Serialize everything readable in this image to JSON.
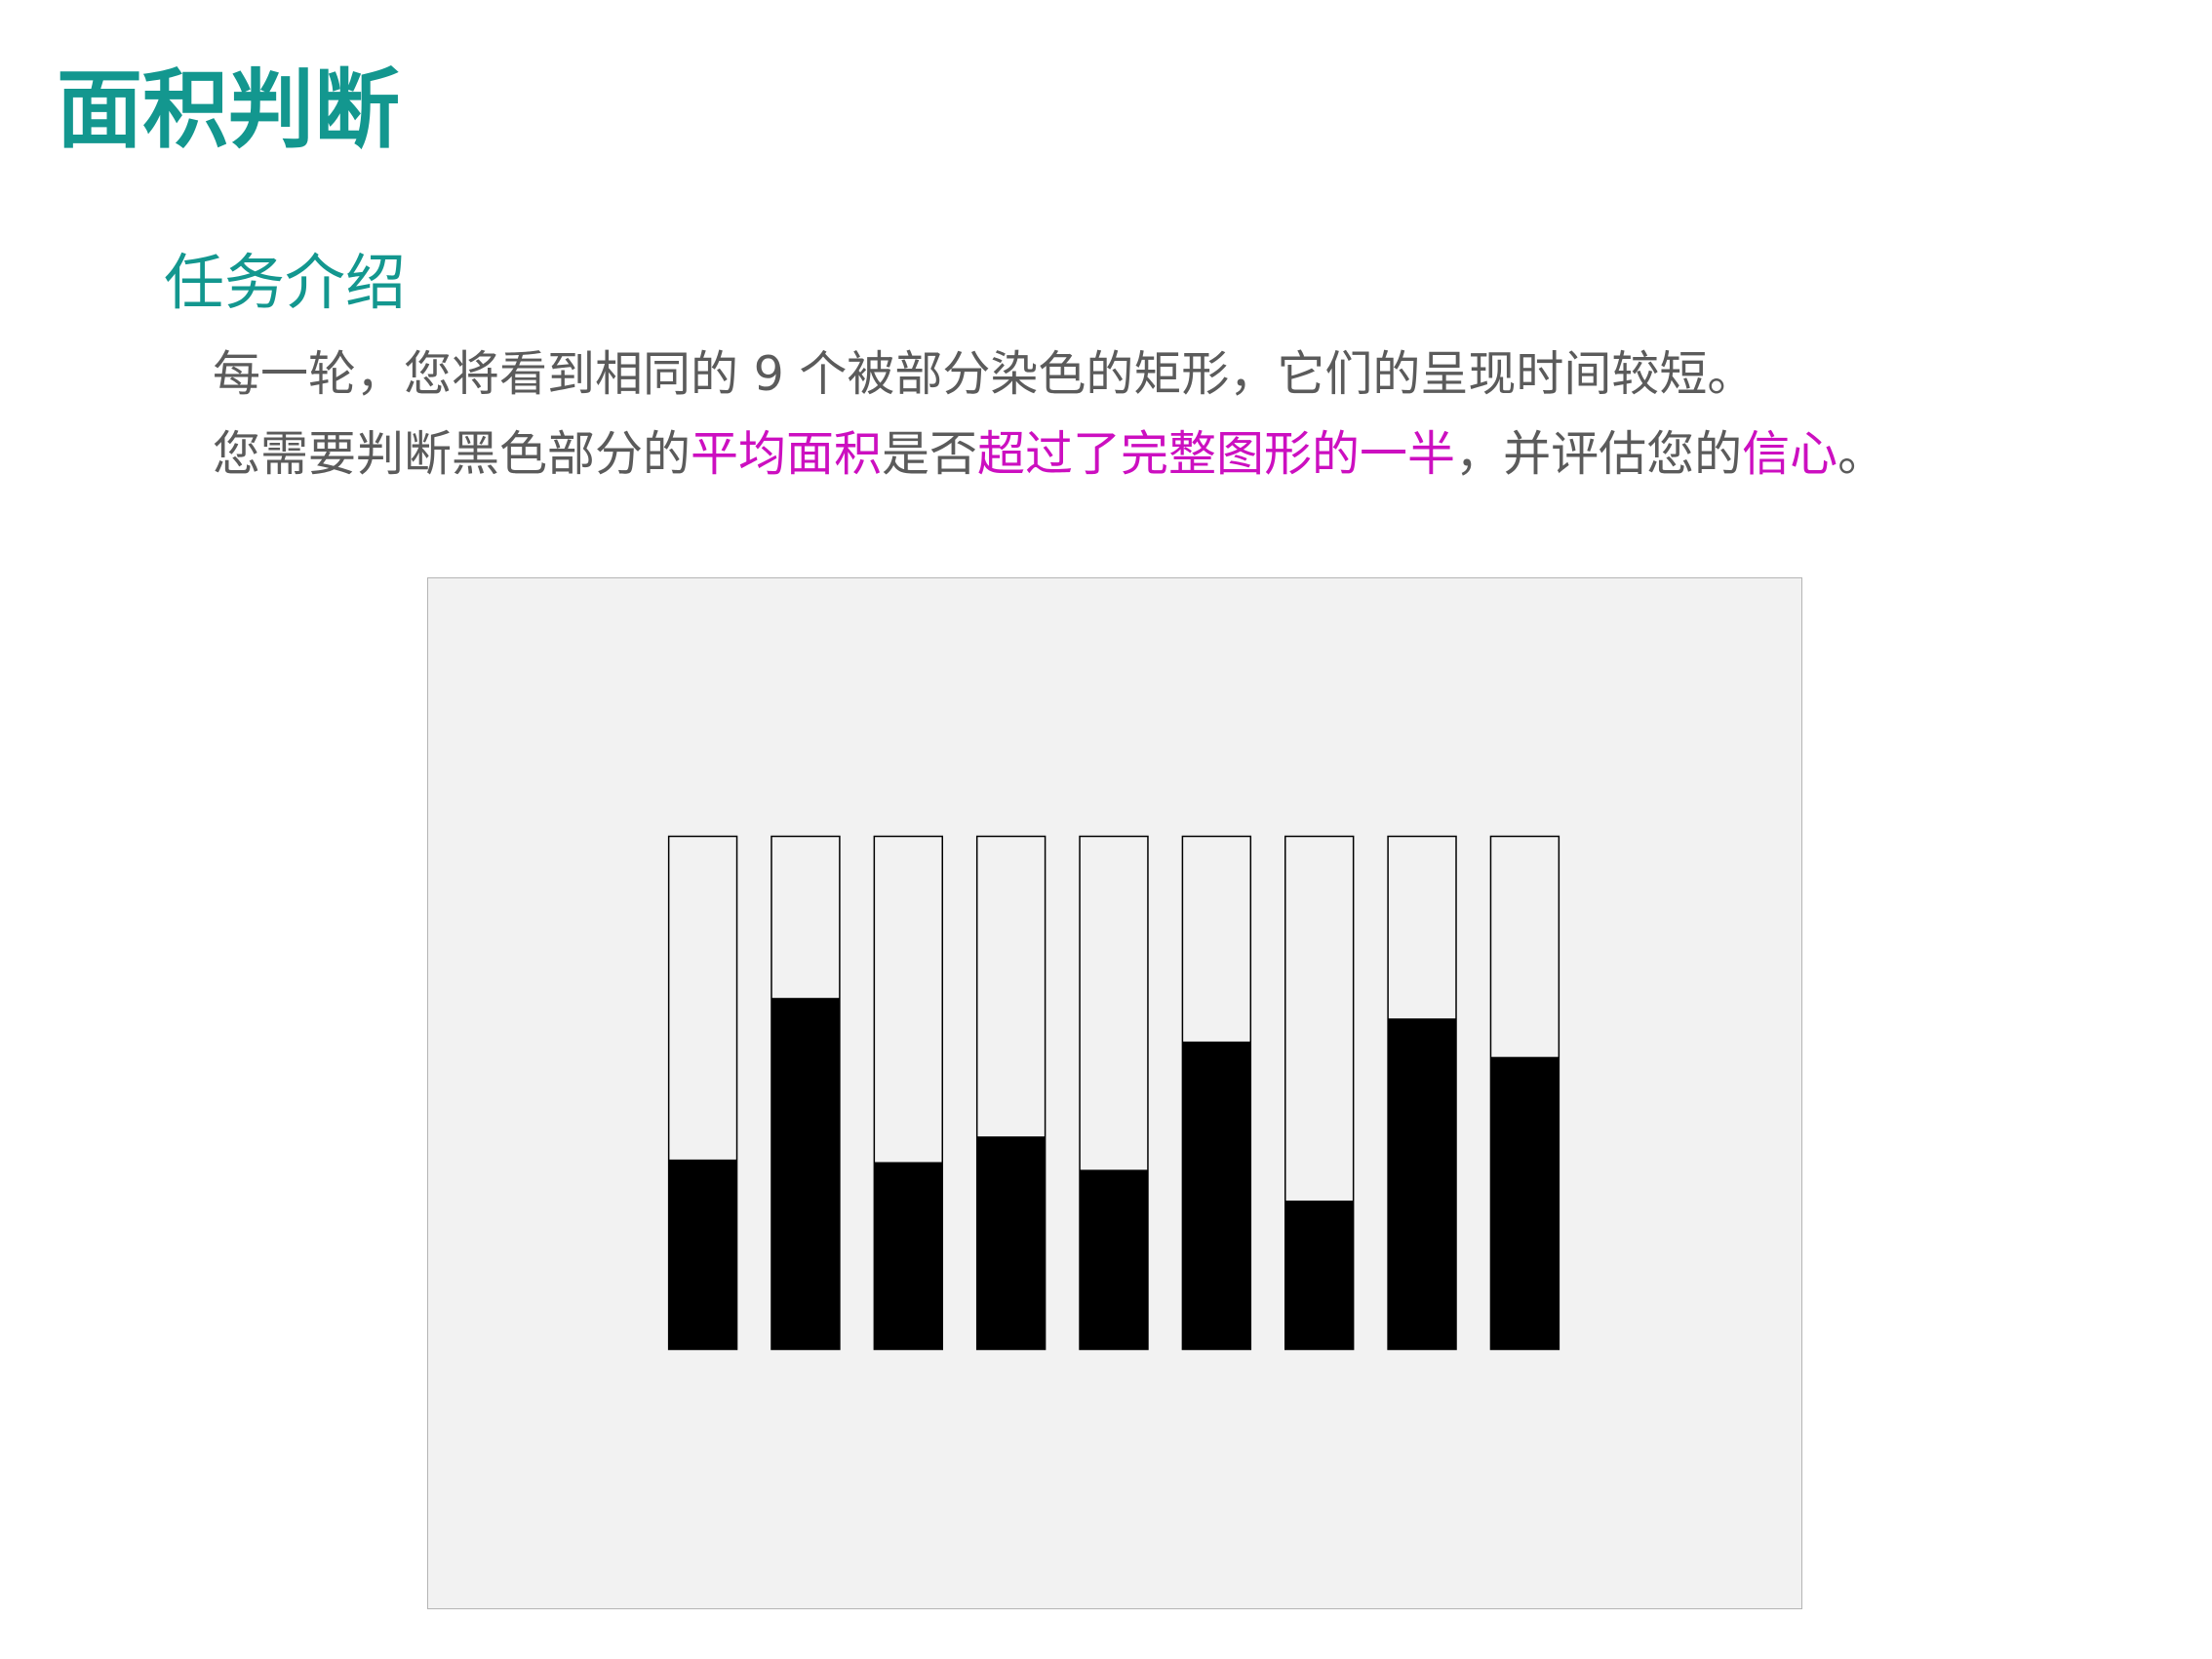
{
  "page": {
    "title": "面积判断"
  },
  "intro": {
    "heading": "任务介绍",
    "line1": "每一轮，您将看到相同的 9 个被部分染色的矩形，它们的呈现时间较短。",
    "line2": [
      {
        "text": "您需要判断黑色部分的",
        "highlight": false
      },
      {
        "text": "平均面积",
        "highlight": true
      },
      {
        "text": "是否",
        "highlight": false
      },
      {
        "text": "超过了完整图形的一半",
        "highlight": true
      },
      {
        "text": "，并评估您的",
        "highlight": false
      },
      {
        "text": "信心",
        "highlight": true
      },
      {
        "text": "。",
        "highlight": false
      }
    ]
  },
  "colors": {
    "title": "#13978f",
    "body_text": "#5b5b5b",
    "highlight": "#cc0fc0",
    "panel_background": "#f2f2f2",
    "rect_empty": "#f2f2f2",
    "rect_fill": "#000000"
  },
  "stimulus": {
    "rectangle_count": 9,
    "black_fractions": [
      0.37,
      0.685,
      0.365,
      0.415,
      0.35,
      0.6,
      0.29,
      0.645,
      0.57
    ]
  }
}
